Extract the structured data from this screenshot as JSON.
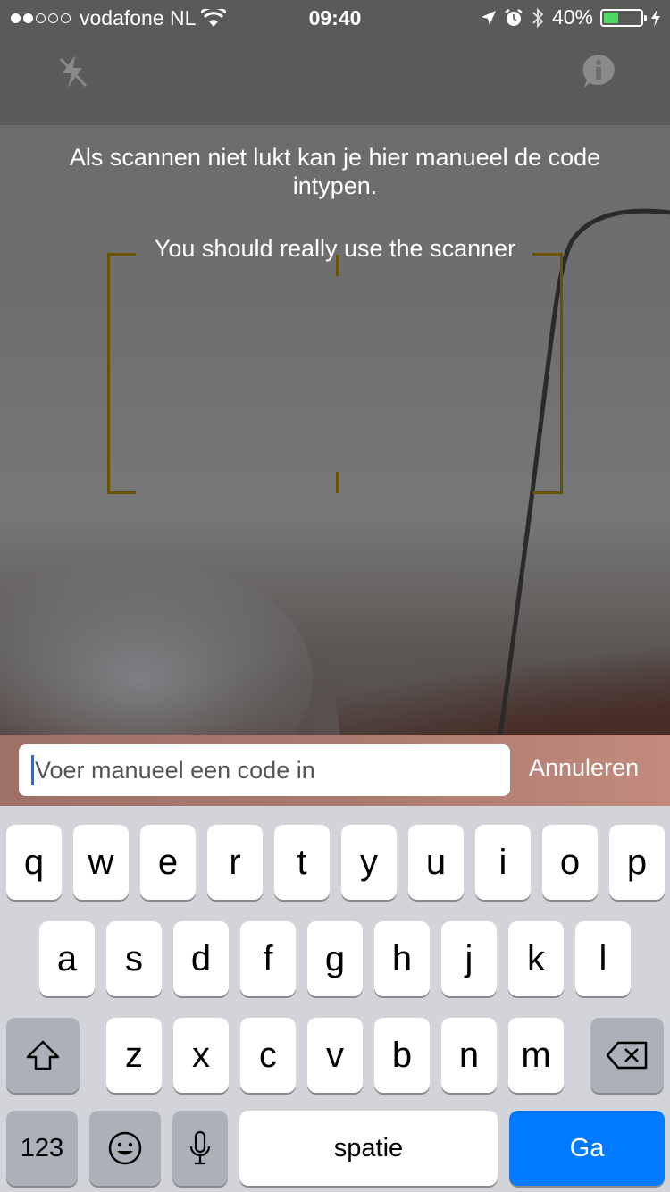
{
  "status_bar": {
    "carrier": "vodafone NL",
    "time": "09:40",
    "battery_percent": "40%",
    "battery_level": 0.4,
    "signal_bars_filled": 2,
    "signal_bars_total": 5
  },
  "toolbar": {
    "flash_icon": "flash-off-icon",
    "info_icon": "info-icon"
  },
  "scanner": {
    "manual_hint": "Als scannen niet lukt kan je hier manueel de code intypen.",
    "scanner_hint": "You should really use the scanner",
    "frame_color": "#6a5200"
  },
  "input": {
    "placeholder": "Voer manueel een code in",
    "value": "",
    "cancel_label": "Annuleren"
  },
  "keyboard": {
    "row1": [
      "q",
      "w",
      "e",
      "r",
      "t",
      "y",
      "u",
      "i",
      "o",
      "p"
    ],
    "row2": [
      "a",
      "s",
      "d",
      "f",
      "g",
      "h",
      "j",
      "k",
      "l"
    ],
    "row3": [
      "z",
      "x",
      "c",
      "v",
      "b",
      "n",
      "m"
    ],
    "numbers_label": "123",
    "space_label": "spatie",
    "go_label": "Ga",
    "accent_color": "#007aff"
  }
}
